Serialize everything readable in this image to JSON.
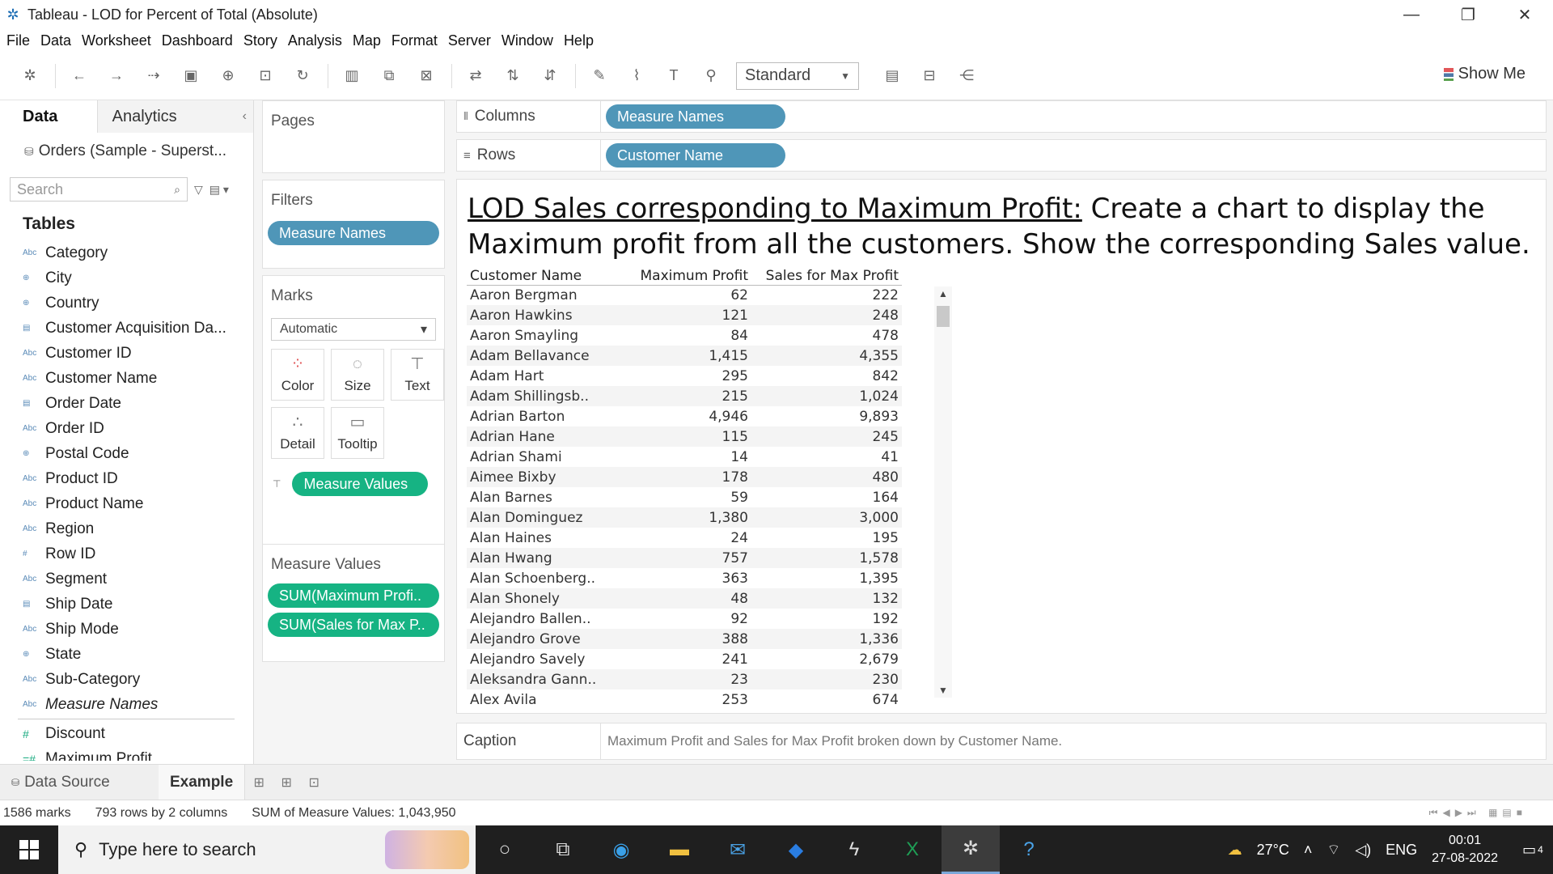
{
  "window": {
    "title": "Tableau - LOD for Percent of Total (Absolute)",
    "controls": [
      "—",
      "❐",
      "✕"
    ]
  },
  "menu": [
    "File",
    "Data",
    "Worksheet",
    "Dashboard",
    "Story",
    "Analysis",
    "Map",
    "Format",
    "Server",
    "Window",
    "Help"
  ],
  "toolbar": {
    "fit_select": "Standard",
    "show_me": "Show Me"
  },
  "data_pane": {
    "tab_data": "Data",
    "tab_analytics": "Analytics",
    "datasource": "Orders (Sample - Superst...",
    "search_placeholder": "Search",
    "tables_header": "Tables",
    "fields": [
      {
        "type": "Abc",
        "name": "Category"
      },
      {
        "type": "geo",
        "name": "City"
      },
      {
        "type": "geo",
        "name": "Country"
      },
      {
        "type": "date",
        "name": "Customer Acquisition Da..."
      },
      {
        "type": "Abc",
        "name": "Customer ID"
      },
      {
        "type": "Abc",
        "name": "Customer Name"
      },
      {
        "type": "date",
        "name": "Order Date"
      },
      {
        "type": "Abc",
        "name": "Order ID"
      },
      {
        "type": "geo",
        "name": "Postal Code"
      },
      {
        "type": "Abc",
        "name": "Product ID"
      },
      {
        "type": "Abc",
        "name": "Product Name"
      },
      {
        "type": "Abc",
        "name": "Region"
      },
      {
        "type": "#",
        "name": "Row ID"
      },
      {
        "type": "Abc",
        "name": "Segment"
      },
      {
        "type": "date",
        "name": "Ship Date"
      },
      {
        "type": "Abc",
        "name": "Ship Mode"
      },
      {
        "type": "geo",
        "name": "State"
      },
      {
        "type": "Abc",
        "name": "Sub-Category"
      },
      {
        "type": "Abc",
        "name": "Measure Names"
      }
    ],
    "measures": [
      {
        "type": "#",
        "name": "Discount"
      },
      {
        "type": "=#",
        "name": "Maximum Profit"
      }
    ]
  },
  "cards": {
    "pages_title": "Pages",
    "filters_title": "Filters",
    "filters_pill": "Measure Names",
    "marks_title": "Marks",
    "marks_type": "Automatic",
    "mark_buttons": [
      "Color",
      "Size",
      "Text",
      "Detail",
      "Tooltip"
    ],
    "marks_pill": "Measure Values",
    "measure_values_title": "Measure Values",
    "mv_pills": [
      "SUM(Maximum Profi..",
      "SUM(Sales for Max P.."
    ]
  },
  "shelves": {
    "columns_label": "Columns",
    "columns_pill": "Measure Names",
    "rows_label": "Rows",
    "rows_pill": "Customer Name"
  },
  "view": {
    "heading_underlined": "LOD Sales corresponding to Maximum Profit:",
    "heading_rest": " Create a chart to display the Maximum profit from all the customers. Show the corresponding Sales value.",
    "col_headers": [
      "Customer Name",
      "Maximum Profit",
      "Sales for Max Profit"
    ],
    "rows": [
      [
        "Aaron Bergman",
        "62",
        "222"
      ],
      [
        "Aaron Hawkins",
        "121",
        "248"
      ],
      [
        "Aaron Smayling",
        "84",
        "478"
      ],
      [
        "Adam Bellavance",
        "1,415",
        "4,355"
      ],
      [
        "Adam Hart",
        "295",
        "842"
      ],
      [
        "Adam Shillingsb..",
        "215",
        "1,024"
      ],
      [
        "Adrian Barton",
        "4,946",
        "9,893"
      ],
      [
        "Adrian Hane",
        "115",
        "245"
      ],
      [
        "Adrian Shami",
        "14",
        "41"
      ],
      [
        "Aimee Bixby",
        "178",
        "480"
      ],
      [
        "Alan Barnes",
        "59",
        "164"
      ],
      [
        "Alan Dominguez",
        "1,380",
        "3,000"
      ],
      [
        "Alan Haines",
        "24",
        "195"
      ],
      [
        "Alan Hwang",
        "757",
        "1,578"
      ],
      [
        "Alan Schoenberg..",
        "363",
        "1,395"
      ],
      [
        "Alan Shonely",
        "48",
        "132"
      ],
      [
        "Alejandro Ballen..",
        "92",
        "192"
      ],
      [
        "Alejandro Grove",
        "388",
        "1,336"
      ],
      [
        "Alejandro Savely",
        "241",
        "2,679"
      ],
      [
        "Aleksandra Gann..",
        "23",
        "230"
      ],
      [
        "Alex Avila",
        "253",
        "674"
      ]
    ]
  },
  "caption": {
    "label": "Caption",
    "text": "Maximum Profit and Sales for Max Profit broken down by Customer Name."
  },
  "sheet_tabs": {
    "data_source": "Data Source",
    "active": "Example"
  },
  "status": {
    "marks": "1586 marks",
    "dims": "793 rows by 2 columns",
    "sum": "SUM of Measure Values: 1,043,950"
  },
  "taskbar": {
    "search_placeholder": "Type here to search",
    "temperature": "27°C",
    "language": "ENG",
    "time": "00:01",
    "date": "27-08-2022",
    "notifications": "4"
  },
  "colors": {
    "pill_blue": "#4f96b8",
    "pill_green": "#16b383",
    "taskbar": "#1f1f1f"
  }
}
